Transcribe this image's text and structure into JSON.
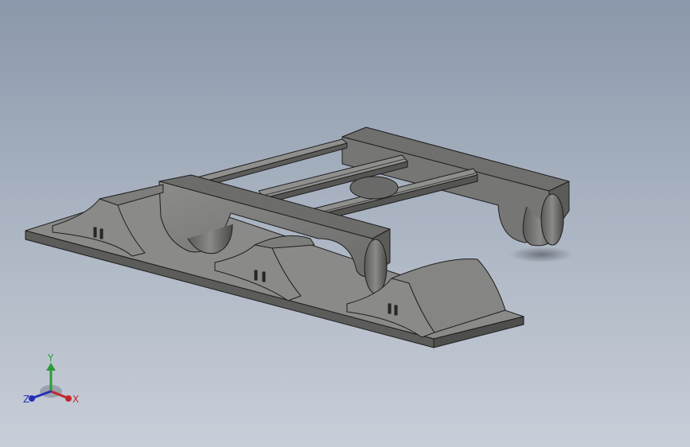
{
  "viewport": {
    "background_top": "#8b98ab",
    "background_bottom": "#c8ced8",
    "part_color": "#7a7a78",
    "edge_color": "#1e1e1e"
  },
  "triad": {
    "x_label": "X",
    "y_label": "Y",
    "z_label": "Z",
    "x_color": "#c0282d",
    "y_color": "#2e9a3a",
    "z_color": "#2430b8"
  }
}
